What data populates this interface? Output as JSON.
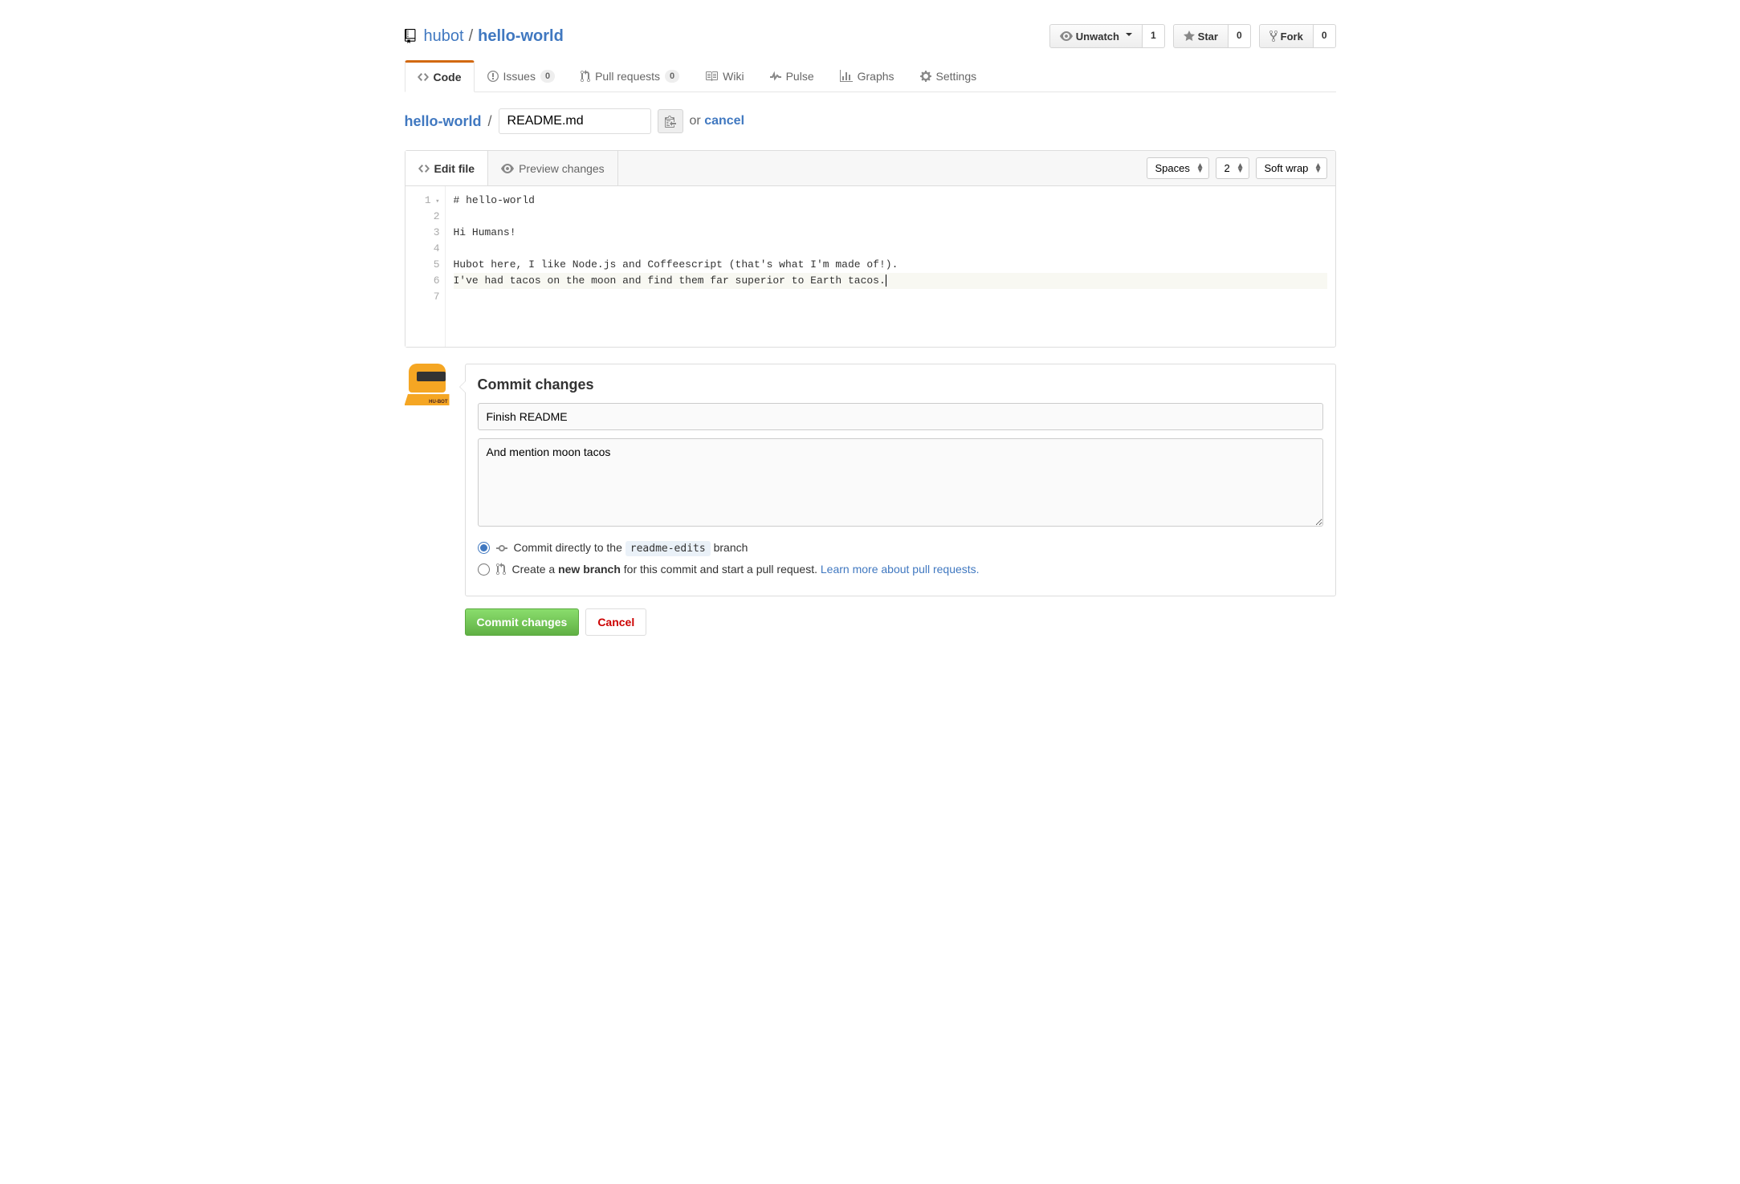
{
  "repo": {
    "owner": "hubot",
    "name": "hello-world",
    "separator": "/"
  },
  "actions": {
    "unwatch": {
      "label": "Unwatch",
      "count": "1"
    },
    "star": {
      "label": "Star",
      "count": "0"
    },
    "fork": {
      "label": "Fork",
      "count": "0"
    }
  },
  "nav": {
    "code": "Code",
    "issues": {
      "label": "Issues",
      "count": "0"
    },
    "pulls": {
      "label": "Pull requests",
      "count": "0"
    },
    "wiki": "Wiki",
    "pulse": "Pulse",
    "graphs": "Graphs",
    "settings": "Settings"
  },
  "breadcrumb": {
    "root": "hello-world",
    "separator": "/",
    "filename": "README.md",
    "or": "or",
    "cancel": "cancel"
  },
  "editor_tabs": {
    "edit": "Edit file",
    "preview": "Preview changes"
  },
  "editor_settings": {
    "indent_mode": "Spaces",
    "indent_size": "2",
    "wrap_mode": "Soft wrap"
  },
  "code_lines": {
    "l1": "# hello-world",
    "l2": "",
    "l3": "Hi Humans!",
    "l4": "",
    "l5": "Hubot here, I like Node.js and Coffeescript (that's what I'm made of!).",
    "l6": "I've had tacos on the moon and find them far superior to Earth tacos.",
    "l7": ""
  },
  "line_numbers": {
    "n1": "1",
    "n2": "2",
    "n3": "3",
    "n4": "4",
    "n5": "5",
    "n6": "6",
    "n7": "7"
  },
  "commit": {
    "heading": "Commit changes",
    "summary": "Finish README",
    "description": "And mention moon tacos",
    "opt_direct_prefix": "Commit directly to the ",
    "opt_direct_branch": "readme-edits",
    "opt_direct_suffix": " branch",
    "opt_new_prefix": "Create a ",
    "opt_new_bold": "new branch",
    "opt_new_suffix": " for this commit and start a pull request. ",
    "opt_new_link": "Learn more about pull requests.",
    "submit": "Commit changes",
    "cancel": "Cancel"
  },
  "avatar_label": "HU-BOT"
}
